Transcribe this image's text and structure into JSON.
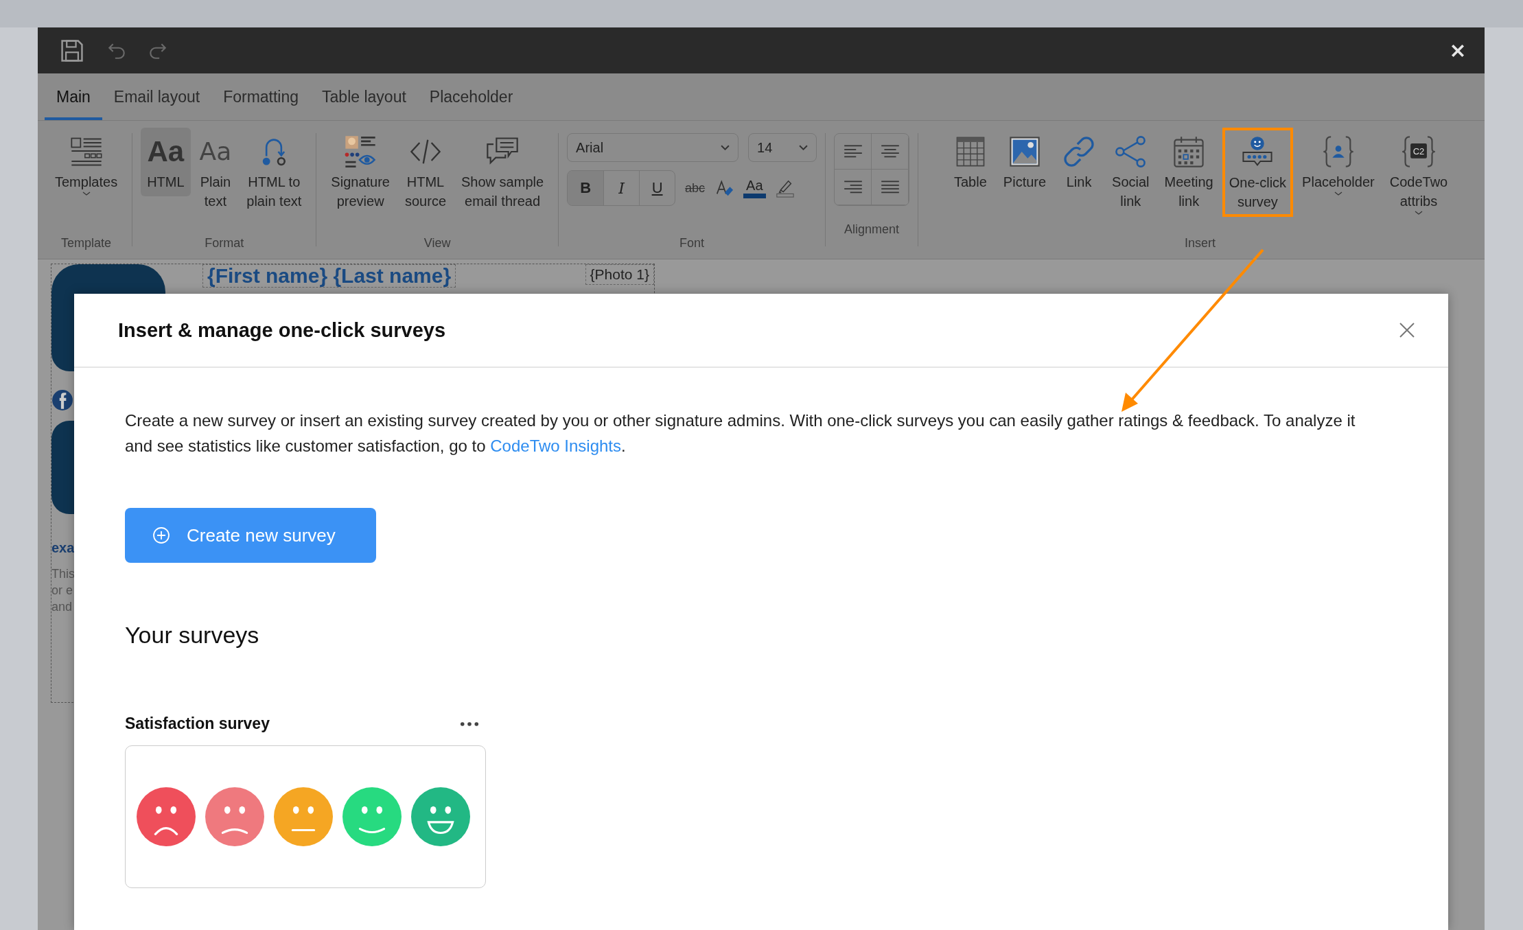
{
  "tabs": [
    {
      "label": "Main",
      "selected": true
    },
    {
      "label": "Email layout",
      "selected": false
    },
    {
      "label": "Formatting",
      "selected": false
    },
    {
      "label": "Table layout",
      "selected": false
    },
    {
      "label": "Placeholder",
      "selected": false
    }
  ],
  "ribbon": {
    "template": {
      "label": "Template",
      "items": [
        {
          "label": "Templates",
          "dropdown": true
        }
      ]
    },
    "format": {
      "label": "Format",
      "items": [
        {
          "label": "HTML",
          "glyph": "Aa",
          "selected": true
        },
        {
          "label": "Plain\ntext",
          "glyph": "Aa",
          "selected": false
        },
        {
          "label": "HTML to\nplain text",
          "selected": false
        }
      ]
    },
    "view": {
      "label": "View",
      "items": [
        {
          "label": "Signature\npreview"
        },
        {
          "label": "HTML\nsource"
        },
        {
          "label": "Show sample\nemail thread"
        }
      ]
    },
    "font": {
      "label": "Font",
      "family": "Arial",
      "size": "14",
      "styles": [
        "B",
        "I",
        "U",
        "abc"
      ],
      "color_glyph": "Aa"
    },
    "alignment": {
      "label": "Alignment"
    },
    "insert": {
      "label": "Insert",
      "items": [
        {
          "label": "Table",
          "dropdown": false,
          "highlighted": false
        },
        {
          "label": "Picture",
          "dropdown": false,
          "highlighted": false
        },
        {
          "label": "Link",
          "dropdown": false,
          "highlighted": false
        },
        {
          "label": "Social\nlink",
          "dropdown": false,
          "highlighted": false
        },
        {
          "label": "Meeting\nlink",
          "dropdown": false,
          "highlighted": false
        },
        {
          "label": "One-click\nsurvey",
          "dropdown": false,
          "highlighted": true
        },
        {
          "label": "Placeholder",
          "dropdown": true,
          "highlighted": false
        },
        {
          "label": "CodeTwo\nattribs",
          "glyph": "C2",
          "dropdown": true,
          "highlighted": false
        }
      ]
    }
  },
  "signature": {
    "name": "{First name} {Last name}",
    "photo": "{Photo 1}",
    "company": "exa",
    "lines": [
      "This",
      "or e",
      "and"
    ]
  },
  "dialog": {
    "title": "Insert & manage one-click surveys",
    "text": "Create a new survey or insert an existing survey created by you or other signature admins. With one-click surveys you can easily gather ratings & feedback. To analyze it and see statistics like customer satisfaction, go to ",
    "link": "CodeTwo Insights",
    "text_end": ".",
    "create_button": "Create new survey",
    "section_title": "Your surveys",
    "surveys": [
      {
        "title": "Satisfaction survey",
        "faces": [
          {
            "kind": "sad",
            "color": "#ef4f5b"
          },
          {
            "kind": "frown",
            "color": "#ef797e"
          },
          {
            "kind": "neutral",
            "color": "#f5a623"
          },
          {
            "kind": "smile",
            "color": "#27da80"
          },
          {
            "kind": "grin",
            "color": "#22b884"
          }
        ]
      }
    ]
  }
}
